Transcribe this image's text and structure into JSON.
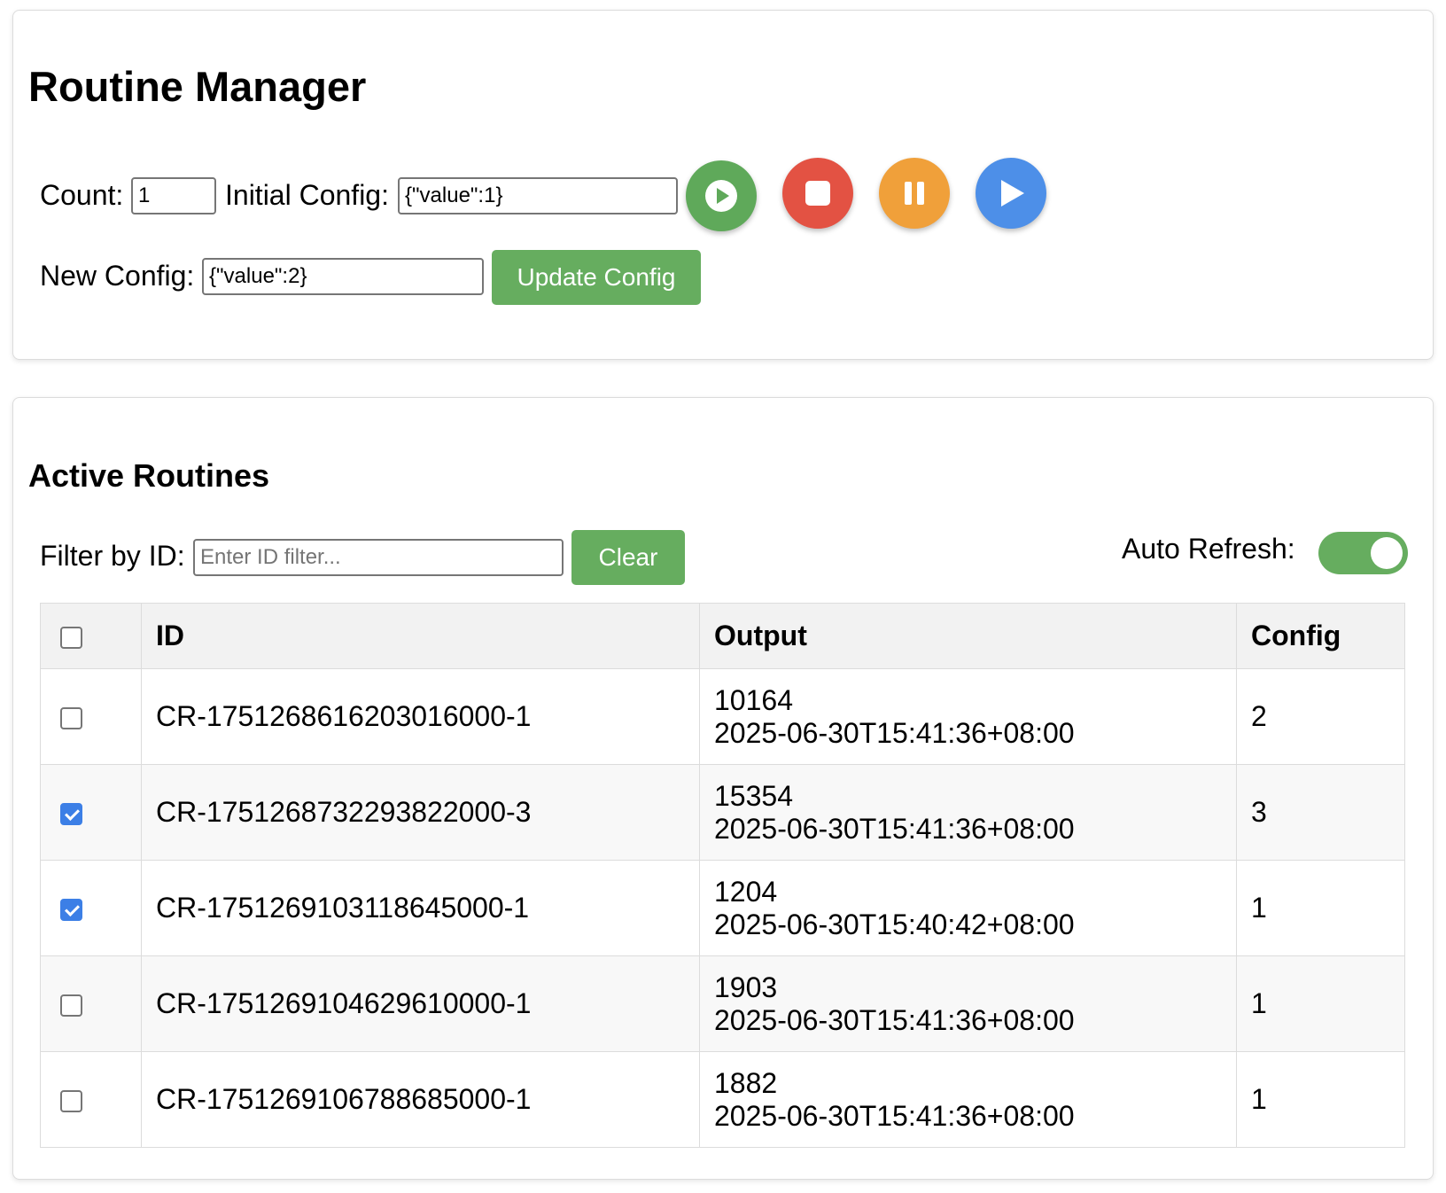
{
  "manager": {
    "title": "Routine Manager",
    "count_label": "Count:",
    "count_value": "1",
    "initial_config_label": "Initial Config:",
    "initial_config_value": "{\"value\":1}",
    "new_config_label": "New Config:",
    "new_config_value": "{\"value\":2}",
    "update_button": "Update Config",
    "action_buttons": [
      {
        "icon": "play-circle-icon",
        "color": "#5fa95a"
      },
      {
        "icon": "stop-icon",
        "color": "#e35243"
      },
      {
        "icon": "pause-icon",
        "color": "#f0a03a"
      },
      {
        "icon": "play-icon",
        "color": "#4d8fe8"
      }
    ]
  },
  "active": {
    "title": "Active Routines",
    "filter_label": "Filter by ID:",
    "filter_placeholder": "Enter ID filter...",
    "clear_button": "Clear",
    "auto_refresh_label": "Auto Refresh:",
    "auto_refresh_on": true,
    "columns": [
      "ID",
      "Output",
      "Config"
    ],
    "rows": [
      {
        "checked": false,
        "id": "CR-1751268616203016000-1",
        "output_value": "10164",
        "output_time": "2025-06-30T15:41:36+08:00",
        "config": "2"
      },
      {
        "checked": true,
        "id": "CR-1751268732293822000-3",
        "output_value": "15354",
        "output_time": "2025-06-30T15:41:36+08:00",
        "config": "3"
      },
      {
        "checked": true,
        "id": "CR-1751269103118645000-1",
        "output_value": "1204",
        "output_time": "2025-06-30T15:40:42+08:00",
        "config": "1"
      },
      {
        "checked": false,
        "id": "CR-1751269104629610000-1",
        "output_value": "1903",
        "output_time": "2025-06-30T15:41:36+08:00",
        "config": "1"
      },
      {
        "checked": false,
        "id": "CR-1751269106788685000-1",
        "output_value": "1882",
        "output_time": "2025-06-30T15:41:36+08:00",
        "config": "1"
      }
    ]
  },
  "colors": {
    "green": "#66ad5f",
    "checkbox_blue": "#3c7fe6"
  }
}
